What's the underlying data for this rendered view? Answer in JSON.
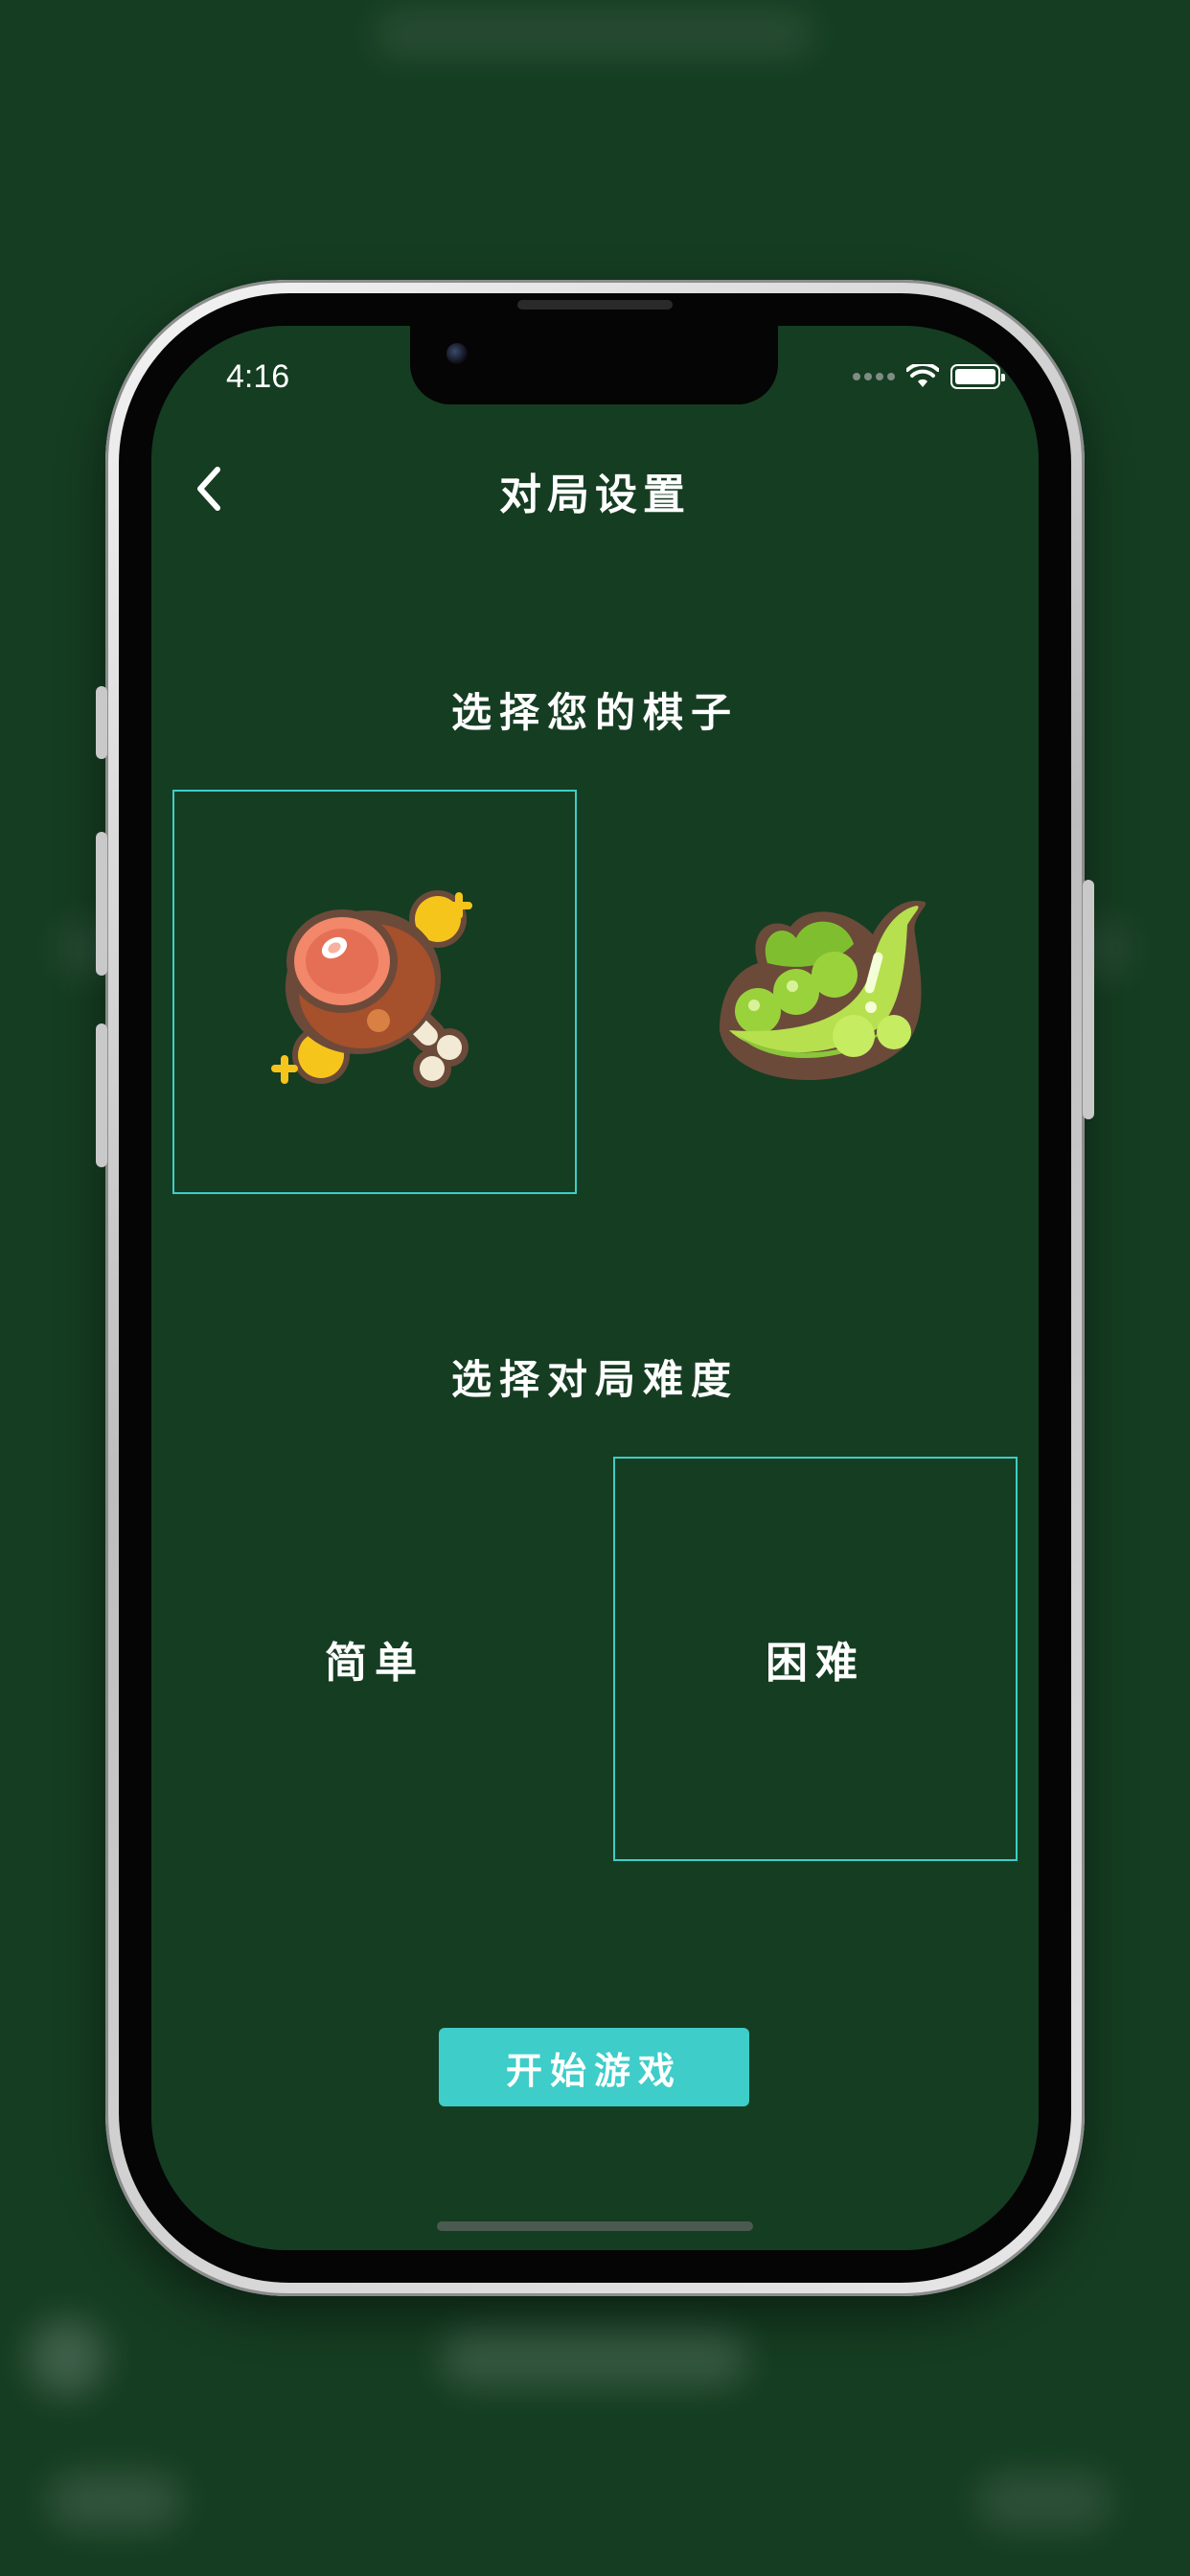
{
  "status_bar": {
    "time": "4:16"
  },
  "header": {
    "title": "对局设置",
    "back_icon": "chevron-left-icon"
  },
  "piece_section": {
    "title": "选择您的棋子",
    "options": [
      {
        "icon": "ham-leg-icon",
        "selected": true
      },
      {
        "icon": "pea-pod-icon",
        "selected": false
      }
    ]
  },
  "difficulty_section": {
    "title": "选择对局难度",
    "options": [
      {
        "label": "简单",
        "selected": false
      },
      {
        "label": "困难",
        "selected": true
      }
    ]
  },
  "start_button": {
    "label": "开始游戏"
  },
  "colors": {
    "background": "#153d22",
    "accent": "#3ecdc8"
  }
}
